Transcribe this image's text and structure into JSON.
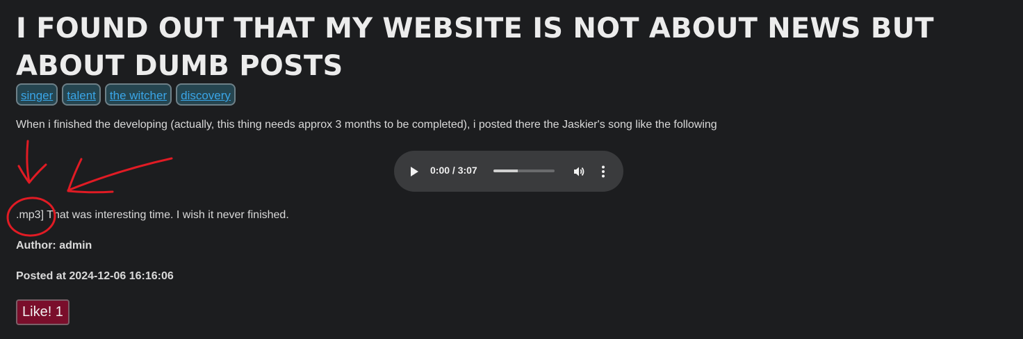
{
  "post": {
    "title": "I FOUND OUT THAT MY WEBSITE IS NOT ABOUT NEWS BUT ABOUT DUMB POSTS",
    "tags": [
      "singer",
      "talent",
      "the witcher",
      "discovery"
    ],
    "intro": "When i finished the developing (actually, this thing needs approx 3 months to be completed), i posted there the Jaskier's song like the following",
    "body": ".mp3] That was interesting time. I wish it never finished.",
    "author": "Author: admin",
    "posted": "Posted at 2024-12-06 16:16:06",
    "like_label": "Like! 1"
  },
  "audio_player": {
    "time": "0:00 / 3:07",
    "progress_fraction": 0.4,
    "icons": [
      "play-icon",
      "volume-icon",
      "more-options-icon"
    ]
  },
  "annotation": {
    "color": "#e01b24",
    "marks": [
      "arrow-down",
      "arrow-left",
      "circle"
    ]
  }
}
